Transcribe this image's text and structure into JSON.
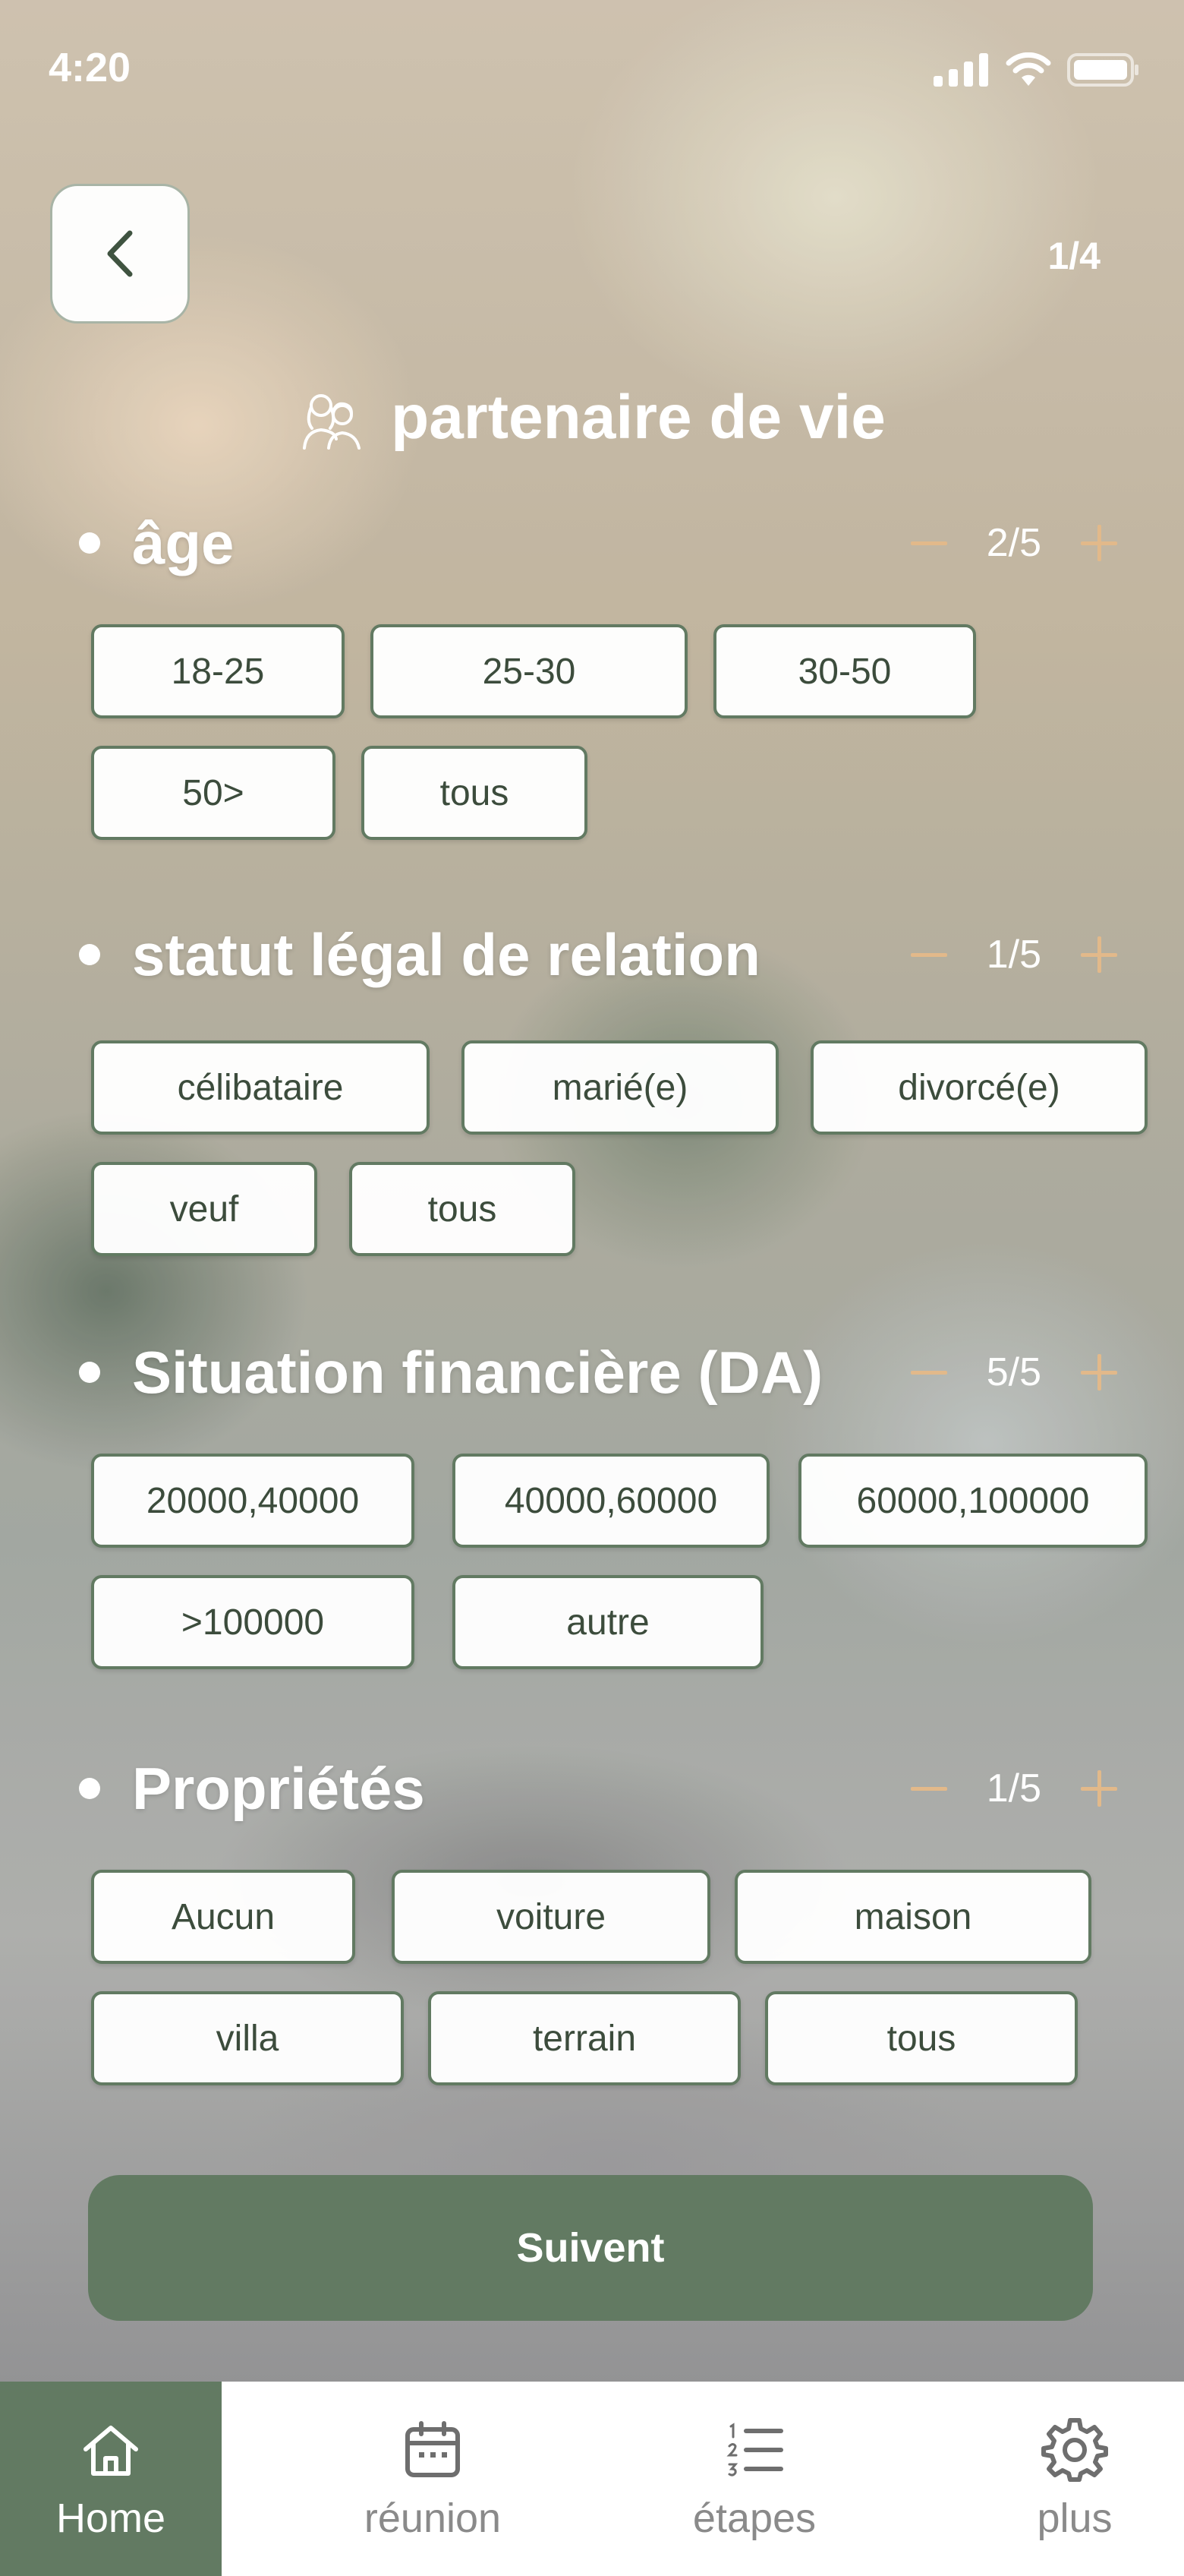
{
  "status_bar": {
    "time": "4:20"
  },
  "header": {
    "pager": "1/4",
    "title": "partenaire de vie"
  },
  "sections": [
    {
      "title": "âge",
      "counter": "2/5",
      "options": [
        "18-25",
        "25-30",
        "30-50",
        "50>",
        "tous"
      ]
    },
    {
      "title": "statut légal de relation",
      "counter": "1/5",
      "options": [
        "célibataire",
        "marié(e)",
        "divorcé(e)",
        "veuf",
        "tous"
      ]
    },
    {
      "title": "Situation financière (DA)",
      "counter": "5/5",
      "options": [
        "20000,40000",
        "40000,60000",
        "60000,100000",
        ">100000",
        "autre"
      ]
    },
    {
      "title": "Propriétés",
      "counter": "1/5",
      "options": [
        "Aucun",
        "voiture",
        "maison",
        "villa",
        "terrain",
        "tous"
      ]
    }
  ],
  "cta": {
    "label": "Suivent"
  },
  "nav": {
    "items": [
      {
        "label": "Home",
        "icon": "home-icon",
        "active": true
      },
      {
        "label": "réunion",
        "icon": "calendar-icon",
        "active": false
      },
      {
        "label": "étapes",
        "icon": "numbered-list-icon",
        "active": false
      },
      {
        "label": "plus",
        "icon": "gear-icon",
        "active": false
      }
    ]
  },
  "colors": {
    "accent": "#627a62",
    "stepper": "#e2b98a",
    "chip_text": "#3c4c3c"
  }
}
